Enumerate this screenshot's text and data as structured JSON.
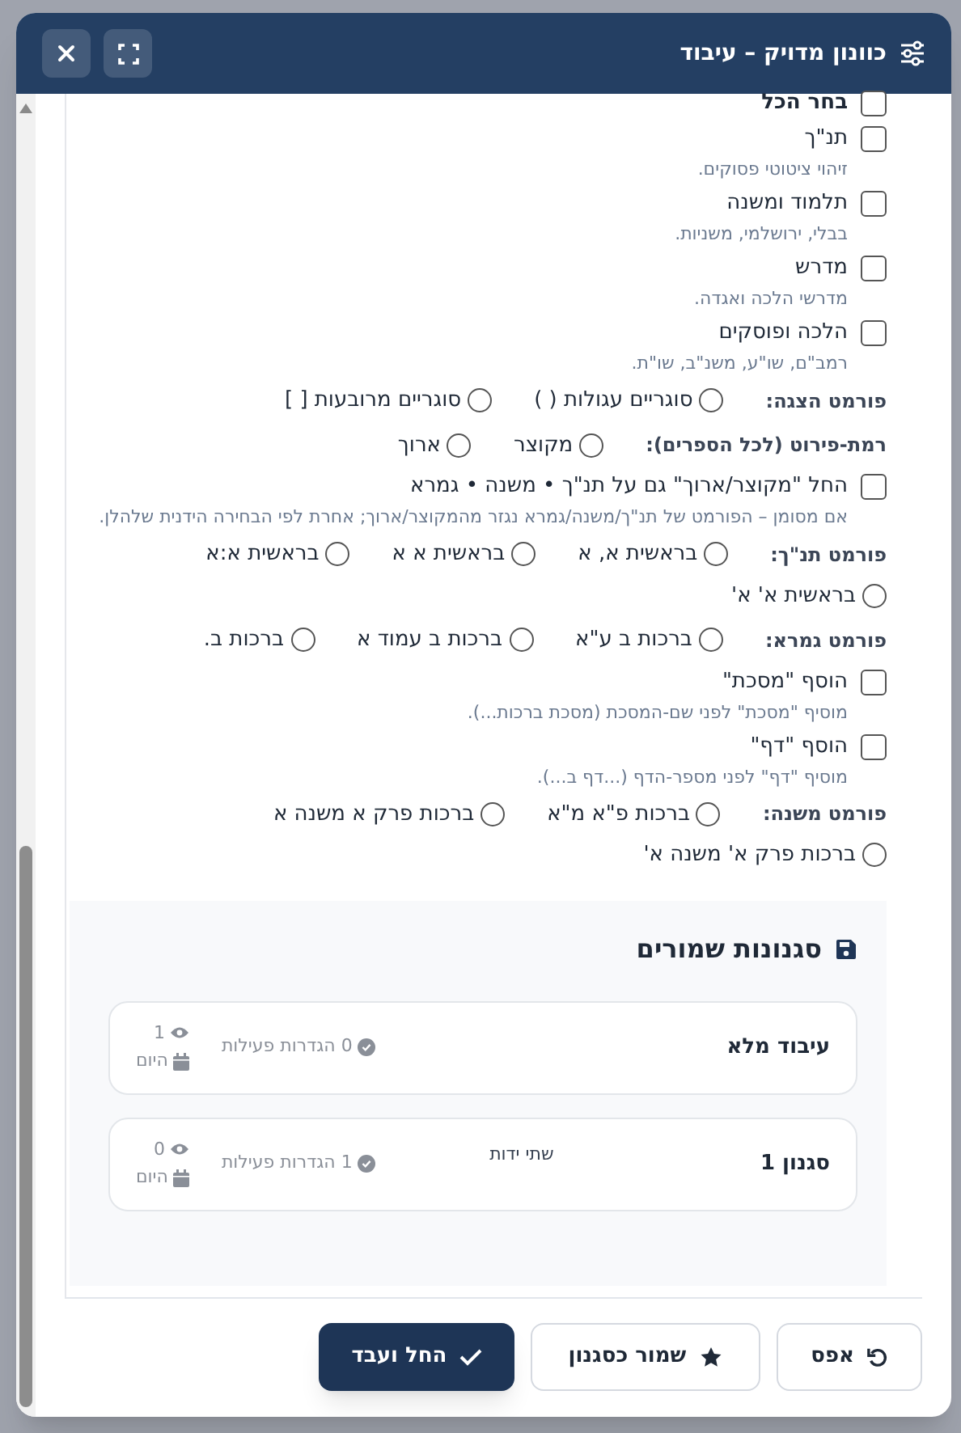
{
  "window": {
    "title": "כוונון מדויק – עיבוד"
  },
  "options": [
    {
      "kind": "select_all",
      "label": "בחר הכל",
      "checked": false
    },
    {
      "kind": "checkbox",
      "label": "תנ\"ך",
      "hint": "זיהוי ציטוטי פסוקים.",
      "checked": false
    },
    {
      "kind": "checkbox",
      "label": "תלמוד ומשנה",
      "hint": "בבלי, ירושלמי, משניות.",
      "checked": false
    },
    {
      "kind": "checkbox",
      "label": "מדרש",
      "hint": "מדרשי הלכה ואגדה.",
      "checked": false
    },
    {
      "kind": "checkbox",
      "label": "הלכה ופוסקים",
      "hint": "רמב\"ם, שו\"ע, משנ\"ב, שו\"ת.",
      "checked": false
    },
    {
      "kind": "radio_group",
      "label": "פורמט הצגה:",
      "options": [
        {
          "label": "סוגריים עגולות ( )",
          "selected": false
        },
        {
          "label": "סוגריים מרובעות [ ]",
          "selected": false
        }
      ]
    },
    {
      "kind": "radio_group",
      "label": "רמת-פירוט (לכל הספרים):",
      "options": [
        {
          "label": "מקוצר",
          "selected": false
        },
        {
          "label": "ארוך",
          "selected": false
        }
      ]
    },
    {
      "kind": "checkbox",
      "label": "החל \"מקוצר/ארוך\" גם על תנ\"ך • משנה • גמרא",
      "hint": "אם מסומן – הפורמט של תנ\"ך/משנה/גמרא נגזר מהמקוצר/ארוך; אחרת לפי הבחירה הידנית שלהלן.",
      "checked": false
    },
    {
      "kind": "radio_group",
      "label": "פורמט תנ\"ך:",
      "options": [
        {
          "label": "בראשית א, א",
          "selected": false
        },
        {
          "label": "בראשית א א",
          "selected": false
        },
        {
          "label": "בראשית א:א",
          "selected": false
        },
        {
          "label": "בראשית א' א'",
          "selected": false
        }
      ]
    },
    {
      "kind": "radio_group",
      "label": "פורמט גמרא:",
      "options": [
        {
          "label": "ברכות ב ע\"א",
          "selected": false
        },
        {
          "label": "ברכות ב עמוד א",
          "selected": false
        },
        {
          "label": "ברכות ב.",
          "selected": false
        }
      ]
    },
    {
      "kind": "checkbox",
      "label": "הוסף \"מסכת\"",
      "hint": "מוסיף \"מסכת\" לפני שם-המסכת (מסכת ברכות...).",
      "checked": false
    },
    {
      "kind": "checkbox",
      "label": "הוסף \"דף\"",
      "hint": "מוסיף \"דף\" לפני מספר-הדף (...דף ב...).",
      "checked": false
    },
    {
      "kind": "radio_group",
      "label": "פורמט משנה:",
      "options": [
        {
          "label": "ברכות פ\"א מ\"א",
          "selected": false
        },
        {
          "label": "ברכות פרק א משנה א",
          "selected": false
        },
        {
          "label": "ברכות פרק א' משנה א'",
          "selected": false
        }
      ]
    }
  ],
  "saved_presets": {
    "title": "סגנונות שמורים",
    "presets": [
      {
        "name": "עיבוד מלא",
        "active_settings": "0 הגדרות פעילות",
        "views": "1",
        "date": "היום"
      },
      {
        "name": "סגנון 1",
        "note": "שתי ידות",
        "active_settings": "1 הגדרות פעילות",
        "views": "0",
        "date": "היום"
      }
    ]
  },
  "footer_buttons": [
    {
      "kind": "reset",
      "label": "אפס"
    },
    {
      "kind": "save",
      "label": "שמור כסגנון"
    },
    {
      "kind": "apply",
      "label": "החל ועבד"
    }
  ]
}
